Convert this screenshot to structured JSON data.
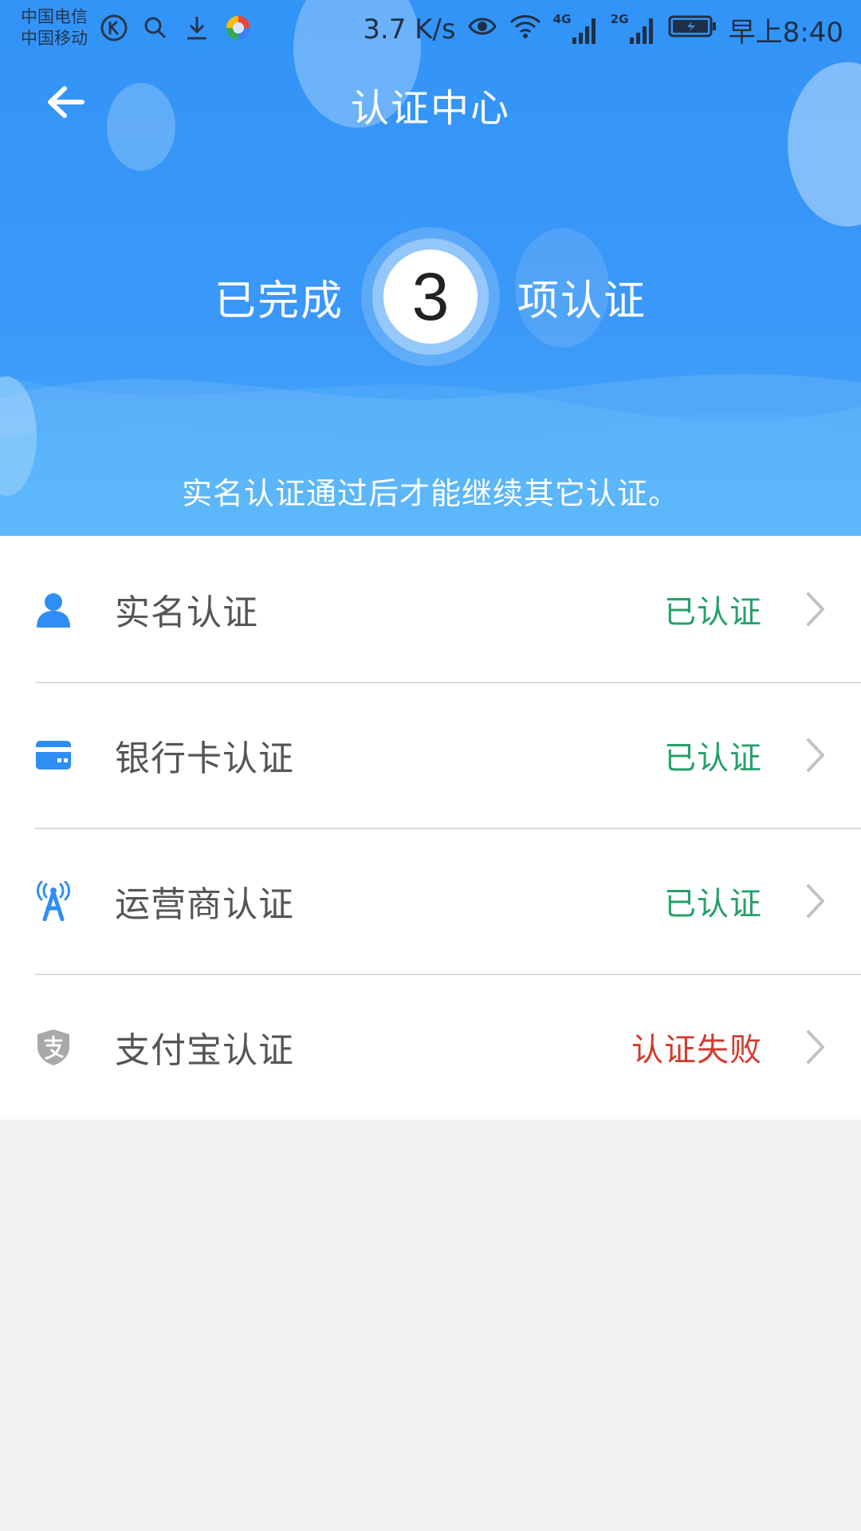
{
  "status_bar": {
    "carrier_1": "中国电信",
    "carrier_2": "中国移动",
    "speed": "3.7 K/s",
    "network_4g": "4G",
    "network_2g": "2G",
    "time": "早上8:40",
    "left_icons": [
      "k-app-icon",
      "search-icon",
      "download-icon",
      "color-app-icon"
    ],
    "right_icons": [
      "eye-icon",
      "wifi-icon",
      "signal-4g-icon",
      "signal-2g-icon",
      "battery-icon"
    ]
  },
  "header": {
    "title": "认证中心",
    "back_icon": "arrow-left-icon",
    "summary_prefix": "已完成",
    "completed_count": "3",
    "summary_suffix": "项认证",
    "hint": "实名认证通过后才能继续其它认证。"
  },
  "items": [
    {
      "label": "实名认证",
      "status": "已认证",
      "icon": "person-icon"
    },
    {
      "label": "银行卡认证",
      "status": "已认证",
      "icon": "bank-card-icon"
    },
    {
      "label": "运营商认证",
      "status": "已认证",
      "icon": "signal-tower-icon"
    },
    {
      "label": "支付宝认证",
      "status": "认证失败",
      "icon": "alipay-shield-icon"
    }
  ],
  "colors": {
    "header_blue": "#3294f7",
    "icon_blue": "#2f8ef5",
    "verified_green": "#26a06a",
    "failed_red": "#d23b2f",
    "chevron_gray": "#c2c2c2"
  }
}
